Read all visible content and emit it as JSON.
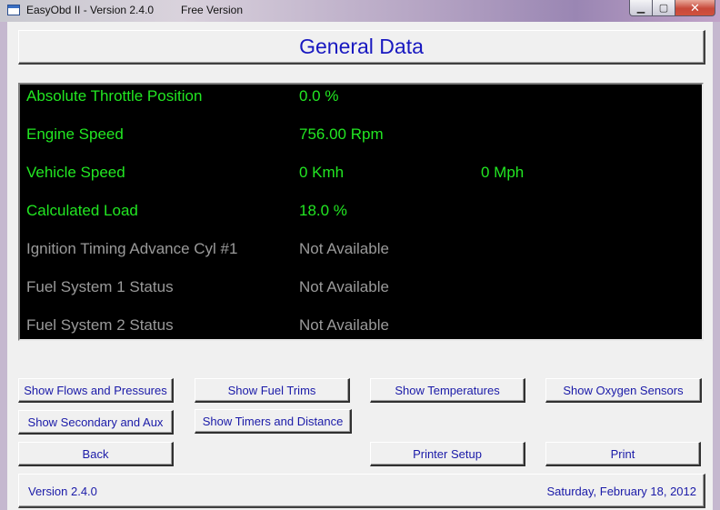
{
  "window": {
    "title": "EasyObd II - Version 2.4.0",
    "edition": "Free Version",
    "controls": {
      "minimize": "▁",
      "maximize": "▢",
      "close": "✕"
    }
  },
  "header": {
    "title": "General Data"
  },
  "data_rows": [
    {
      "label": "Absolute Throttle Position",
      "value": "0.0 %",
      "value2": "",
      "available": true
    },
    {
      "label": "Engine Speed",
      "value": "756.00 Rpm",
      "value2": "",
      "available": true
    },
    {
      "label": "Vehicle Speed",
      "value": "0 Kmh",
      "value2": "0 Mph",
      "available": true
    },
    {
      "label": "Calculated Load",
      "value": "18.0 %",
      "value2": "",
      "available": true
    },
    {
      "label": "Ignition Timing Advance Cyl #1",
      "value": "Not Available",
      "value2": "",
      "available": false
    },
    {
      "label": "Fuel System 1 Status",
      "value": "Not Available",
      "value2": "",
      "available": false
    },
    {
      "label": "Fuel System 2 Status",
      "value": "Not Available",
      "value2": "",
      "available": false
    }
  ],
  "buttons": {
    "flows_pressures": "Show Flows and Pressures",
    "fuel_trims": "Show Fuel Trims",
    "temperatures": "Show Temperatures",
    "oxygen_sensors": "Show Oxygen Sensors",
    "secondary_aux": "Show Secondary and Aux",
    "timers_distance": "Show Timers and Distance",
    "back": "Back",
    "printer_setup": "Printer Setup",
    "print": "Print"
  },
  "status": {
    "version": "Version 2.4.0",
    "date": "Saturday, February 18, 2012"
  },
  "colors": {
    "active_text": "#22e622",
    "inactive_text": "#9a9a9a",
    "button_text": "#1a1aa8",
    "heading_text": "#1818c0",
    "data_background": "#000000"
  }
}
